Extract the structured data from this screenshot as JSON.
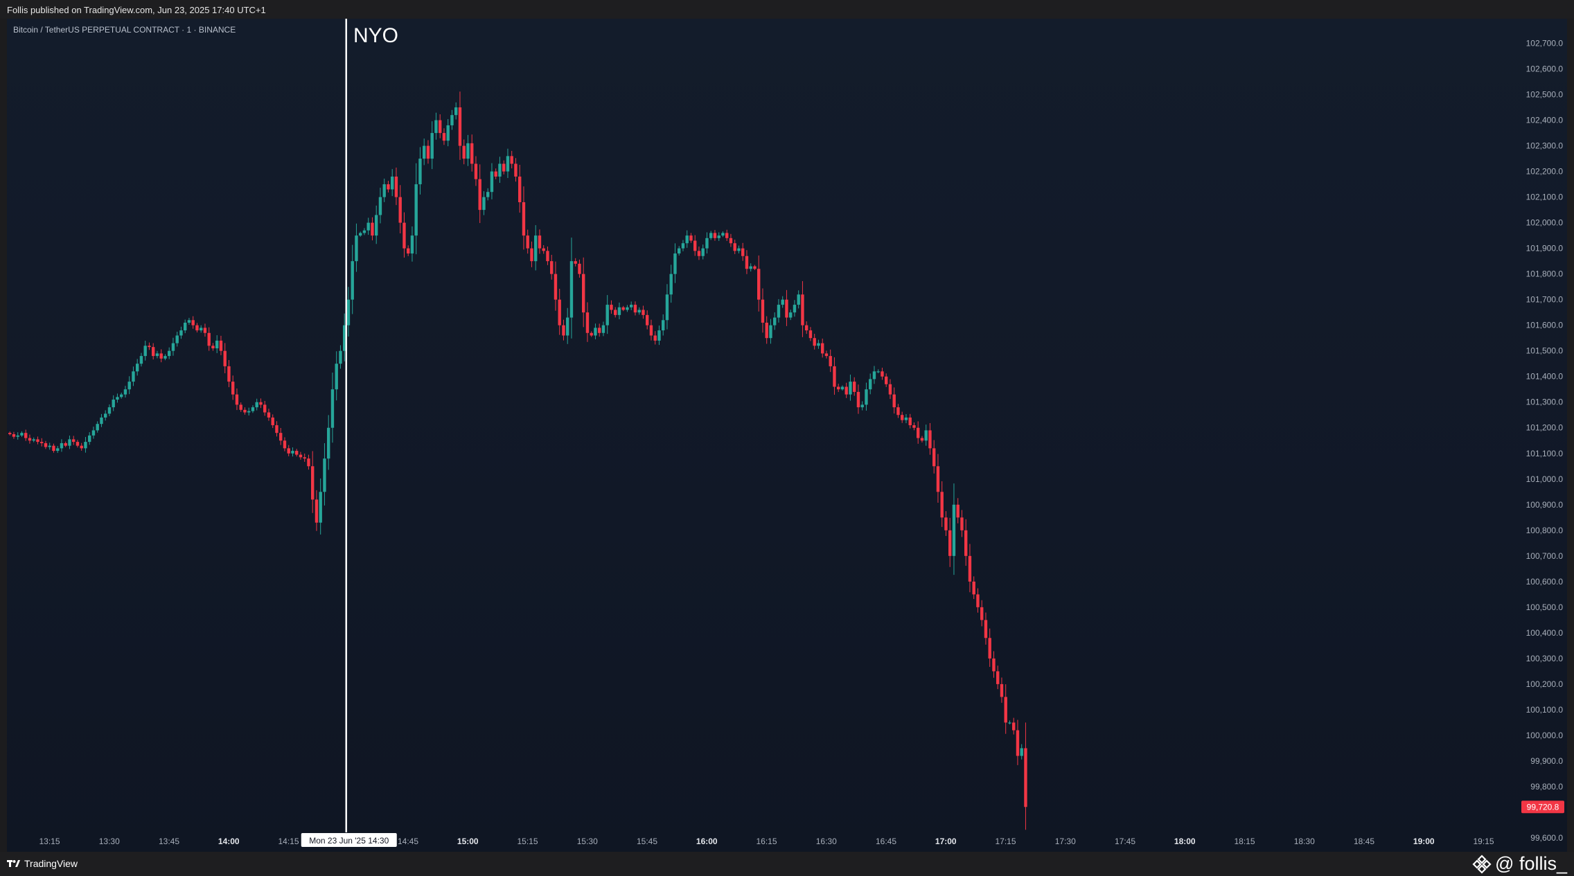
{
  "header": {
    "published": "Follis published on TradingView.com, Jun 23, 2025 17:40 UTC+1"
  },
  "chart": {
    "symbol_label": "Bitcoin / TetherUS PERPETUAL CONTRACT · 1 · BINANCE",
    "annotation": "NYO",
    "crosshair_time_label": "Mon 23 Jun '25   14:30",
    "last_price_label": "99,720.8",
    "colors": {
      "up": "#26a69a",
      "down": "#f23645",
      "background": "#131c2b",
      "crosshair": "#ffffff"
    }
  },
  "chart_data": {
    "type": "candlestick",
    "ylim": [
      99600,
      102750
    ],
    "yticks": [
      99600,
      99800,
      99900,
      100000,
      100100,
      100200,
      100300,
      100400,
      100500,
      100600,
      100700,
      100800,
      100900,
      101000,
      101100,
      101200,
      101300,
      101400,
      101500,
      101600,
      101700,
      101800,
      101900,
      102000,
      102100,
      102200,
      102300,
      102400,
      102500,
      102600,
      102700
    ],
    "ytick_labels": [
      "99,600.0",
      "99,800.0",
      "99,900.0",
      "100,000.0",
      "100,100.0",
      "100,200.0",
      "100,300.0",
      "100,400.0",
      "100,500.0",
      "100,600.0",
      "100,700.0",
      "100,800.0",
      "100,900.0",
      "101,000.0",
      "101,100.0",
      "101,200.0",
      "101,300.0",
      "101,400.0",
      "101,500.0",
      "101,600.0",
      "101,700.0",
      "101,800.0",
      "101,900.0",
      "102,000.0",
      "102,100.0",
      "102,200.0",
      "102,300.0",
      "102,400.0",
      "102,500.0",
      "102,600.0",
      "102,700.0"
    ],
    "xticks": [
      {
        "label": "13:15",
        "bold": false
      },
      {
        "label": "13:30",
        "bold": false
      },
      {
        "label": "13:45",
        "bold": false
      },
      {
        "label": "14:00",
        "bold": true
      },
      {
        "label": "14:15",
        "bold": false
      },
      {
        "label": "14:45",
        "bold": false
      },
      {
        "label": "15:00",
        "bold": true
      },
      {
        "label": "15:15",
        "bold": false
      },
      {
        "label": "15:30",
        "bold": false
      },
      {
        "label": "15:45",
        "bold": false
      },
      {
        "label": "16:00",
        "bold": true
      },
      {
        "label": "16:15",
        "bold": false
      },
      {
        "label": "16:30",
        "bold": false
      },
      {
        "label": "16:45",
        "bold": false
      },
      {
        "label": "17:00",
        "bold": true
      },
      {
        "label": "17:15",
        "bold": false
      },
      {
        "label": "17:30",
        "bold": false
      },
      {
        "label": "17:45",
        "bold": false
      },
      {
        "label": "18:00",
        "bold": true
      },
      {
        "label": "18:15",
        "bold": false
      },
      {
        "label": "18:30",
        "bold": false
      },
      {
        "label": "18:45",
        "bold": false
      },
      {
        "label": "19:00",
        "bold": true
      },
      {
        "label": "19:15",
        "bold": false
      }
    ],
    "time_start": "13:05",
    "interval_minutes": 1,
    "last_price": 99720.8,
    "closes": [
      101175,
      101165,
      101170,
      101180,
      101160,
      101150,
      101155,
      101145,
      101140,
      101125,
      101130,
      101110,
      101120,
      101140,
      101130,
      101155,
      101145,
      101130,
      101120,
      101145,
      101170,
      101190,
      101215,
      101240,
      101255,
      101280,
      101310,
      101320,
      101330,
      101350,
      101380,
      101420,
      101450,
      101480,
      101520,
      101515,
      101480,
      101490,
      101470,
      101480,
      101500,
      101530,
      101560,
      101580,
      101610,
      101620,
      101600,
      101580,
      101590,
      101570,
      101520,
      101510,
      101540,
      101500,
      101440,
      101380,
      101330,
      101290,
      101270,
      101260,
      101265,
      101280,
      101300,
      101290,
      101260,
      101240,
      101210,
      101180,
      101150,
      101120,
      101100,
      101110,
      101095,
      101085,
      101080,
      101050,
      100920,
      100830,
      100950,
      101080,
      101200,
      101350,
      101450,
      101500,
      101600,
      101700,
      101850,
      101950,
      101960,
      101970,
      102000,
      101950,
      102030,
      102100,
      102150,
      102130,
      102180,
      102100,
      102000,
      101900,
      101880,
      101950,
      102150,
      102250,
      102300,
      102250,
      102350,
      102400,
      102350,
      102320,
      102380,
      102420,
      102450,
      102300,
      102250,
      102310,
      102230,
      102170,
      102050,
      102100,
      102120,
      102200,
      102180,
      102230,
      102200,
      102260,
      102230,
      102180,
      102080,
      101950,
      101900,
      101850,
      101950,
      101900,
      101890,
      101850,
      101800,
      101700,
      101600,
      101560,
      101630,
      101850,
      101840,
      101800,
      101650,
      101570,
      101560,
      101590,
      101570,
      101600,
      101680,
      101660,
      101640,
      101670,
      101660,
      101670,
      101680,
      101650,
      101660,
      101640,
      101600,
      101560,
      101540,
      101580,
      101620,
      101720,
      101800,
      101880,
      101900,
      101920,
      101950,
      101930,
      101890,
      101870,
      101900,
      101940,
      101960,
      101940,
      101950,
      101960,
      101940,
      101920,
      101890,
      101900,
      101870,
      101820,
      101830,
      101820,
      101700,
      101610,
      101550,
      101600,
      101630,
      101680,
      101700,
      101630,
      101650,
      101680,
      101720,
      101600,
      101580,
      101550,
      101520,
      101530,
      101490,
      101480,
      101440,
      101360,
      101350,
      101360,
      101330,
      101380,
      101340,
      101280,
      101290,
      101350,
      101390,
      101420,
      101420,
      101400,
      101370,
      101330,
      101280,
      101250,
      101230,
      101240,
      101210,
      101200,
      101160,
      101150,
      101190,
      101120,
      101050,
      100950,
      100850,
      100800,
      100700,
      100900,
      100850,
      100800,
      100700,
      100600,
      100550,
      100500,
      100450,
      100380,
      100300,
      100250,
      100200,
      100150,
      100050,
      100050,
      100020,
      99920,
      99950,
      99720.8
    ]
  }
}
